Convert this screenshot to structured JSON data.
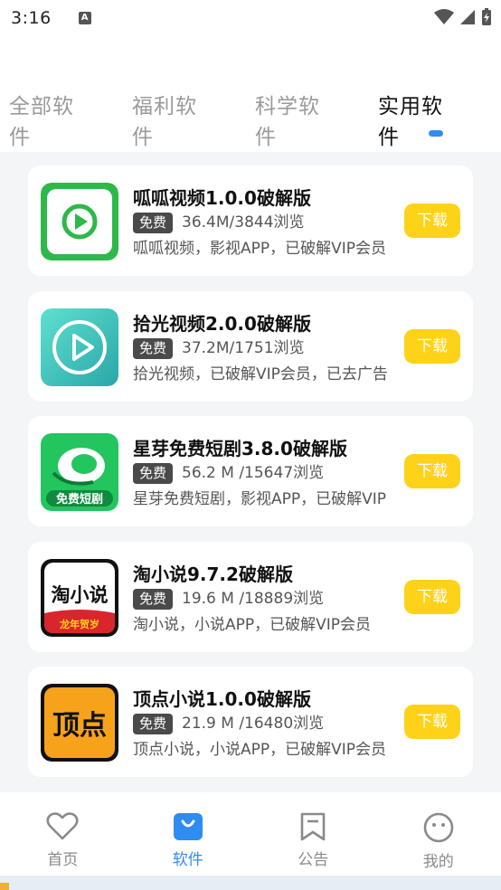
{
  "status_bar": {
    "time": "3:16",
    "notification_letter": "A"
  },
  "tabs": [
    {
      "label": "全部软件",
      "active": false
    },
    {
      "label": "福利软件",
      "active": false
    },
    {
      "label": "科学软件",
      "active": false
    },
    {
      "label": "实用软件",
      "active": true
    }
  ],
  "apps": [
    {
      "title": "呱呱视频1.0.0破解版",
      "badge": "免费",
      "meta": "36.4M/3844浏览",
      "desc": "呱呱视频，影视APP，已破解VIP会员",
      "button": "下载",
      "icon": "guagua-video-icon"
    },
    {
      "title": "拾光视频2.0.0破解版",
      "badge": "免费",
      "meta": "37.2M/1751浏览",
      "desc": "拾光视频，已破解VIP会员，已去广告",
      "button": "下载",
      "icon": "shiguang-video-icon"
    },
    {
      "title": "星芽免费短剧3.8.0破解版",
      "badge": "免费",
      "meta": "56.2 M /15647浏览",
      "desc": "星芽免费短剧，影视APP，已破解VIP",
      "button": "下载",
      "icon": "xingya-drama-icon",
      "icon_label": "免费短剧"
    },
    {
      "title": "淘小说9.7.2破解版",
      "badge": "免费",
      "meta": "19.6 M /18889浏览",
      "desc": "淘小说，小说APP，已破解VIP会员",
      "button": "下载",
      "icon": "tao-novel-icon",
      "icon_label": "淘小说",
      "icon_sublabel": "龙年贺岁"
    },
    {
      "title": "顶点小说1.0.0破解版",
      "badge": "免费",
      "meta": "21.9 M /16480浏览",
      "desc": "顶点小说，小说APP，已破解VIP会员",
      "button": "下载",
      "icon": "dingdian-novel-icon",
      "icon_label": "顶点"
    }
  ],
  "bottom_nav": [
    {
      "label": "首页",
      "icon": "heart-icon",
      "active": false
    },
    {
      "label": "软件",
      "icon": "bag-icon",
      "active": true
    },
    {
      "label": "公告",
      "icon": "bookmark-icon",
      "active": false
    },
    {
      "label": "我的",
      "icon": "smiley-icon",
      "active": false
    }
  ],
  "colors": {
    "accent": "#2f8cf0",
    "download": "#ffd21a",
    "badge": "#4a4a4a"
  }
}
